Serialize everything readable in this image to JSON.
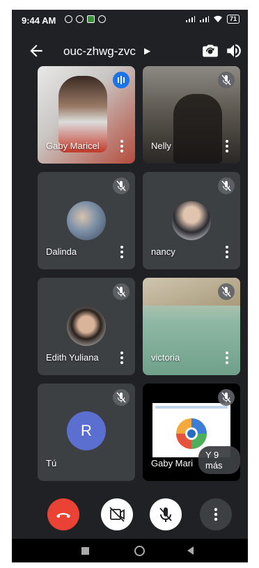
{
  "status_bar": {
    "time": "9:44 AM",
    "battery": "71"
  },
  "top_bar": {
    "meeting_code": "ouc-zhwg-zvc"
  },
  "participants": [
    {
      "name": "Gaby Maricel",
      "muted": false,
      "speaking": true
    },
    {
      "name": "Nelly",
      "muted": true
    },
    {
      "name": "Dalinda",
      "muted": true
    },
    {
      "name": "nancy",
      "muted": true
    },
    {
      "name": "Edith Yuliana",
      "muted": true
    },
    {
      "name": "victoria",
      "muted": true
    },
    {
      "name": "Tú",
      "initial": "R",
      "muted": true
    },
    {
      "name": "Gaby Mari",
      "muted": true,
      "more_label": "Y 9 más"
    }
  ],
  "colors": {
    "end_call": "#ea4335",
    "avatar_r": "#5b6fd1",
    "speaking": "#1a73e8"
  },
  "icons": [
    "back-arrow-icon",
    "switch-camera-icon",
    "speaker-icon",
    "mic-off-icon",
    "end-call-icon",
    "camera-off-icon",
    "more-vert-icon"
  ]
}
